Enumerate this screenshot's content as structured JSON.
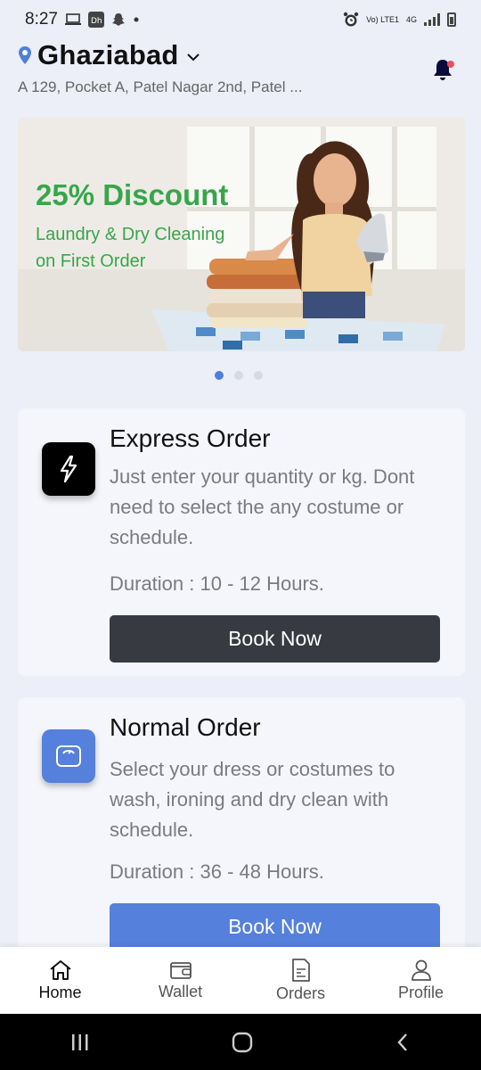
{
  "status_bar": {
    "time": "8:27",
    "network_top": "Vo) LTE1",
    "network_4g": "4G"
  },
  "header": {
    "city": "Ghaziabad",
    "address": "A 129, Pocket A, Patel Nagar 2nd, Patel ..."
  },
  "banner": {
    "title": "25% Discount",
    "subtitle_line1": "Laundry & Dry Cleaning",
    "subtitle_line2": "on First Order",
    "accent_color": "#37a64a"
  },
  "carousel": {
    "count": 3,
    "active_index": 0
  },
  "orders": [
    {
      "title": "Express Order",
      "description": "Just enter your quantity or kg. Dont need to select the any costume or schedule.",
      "duration": "Duration : 10 - 12 Hours.",
      "button_label": "Book Now",
      "icon": "lightning-icon",
      "button_color": "#373a40"
    },
    {
      "title": "Normal Order",
      "description": "Select your dress or costumes to wash, ironing and dry clean with schedule.",
      "duration": "Duration : 36 - 48 Hours.",
      "button_label": "Book Now",
      "icon": "scale-icon",
      "button_color": "#5580dc"
    }
  ],
  "bottom_nav": {
    "items": [
      {
        "label": "Home",
        "icon": "home-icon",
        "active": true
      },
      {
        "label": "Wallet",
        "icon": "wallet-icon",
        "active": false
      },
      {
        "label": "Orders",
        "icon": "orders-icon",
        "active": false
      },
      {
        "label": "Profile",
        "icon": "profile-icon",
        "active": false
      }
    ]
  }
}
